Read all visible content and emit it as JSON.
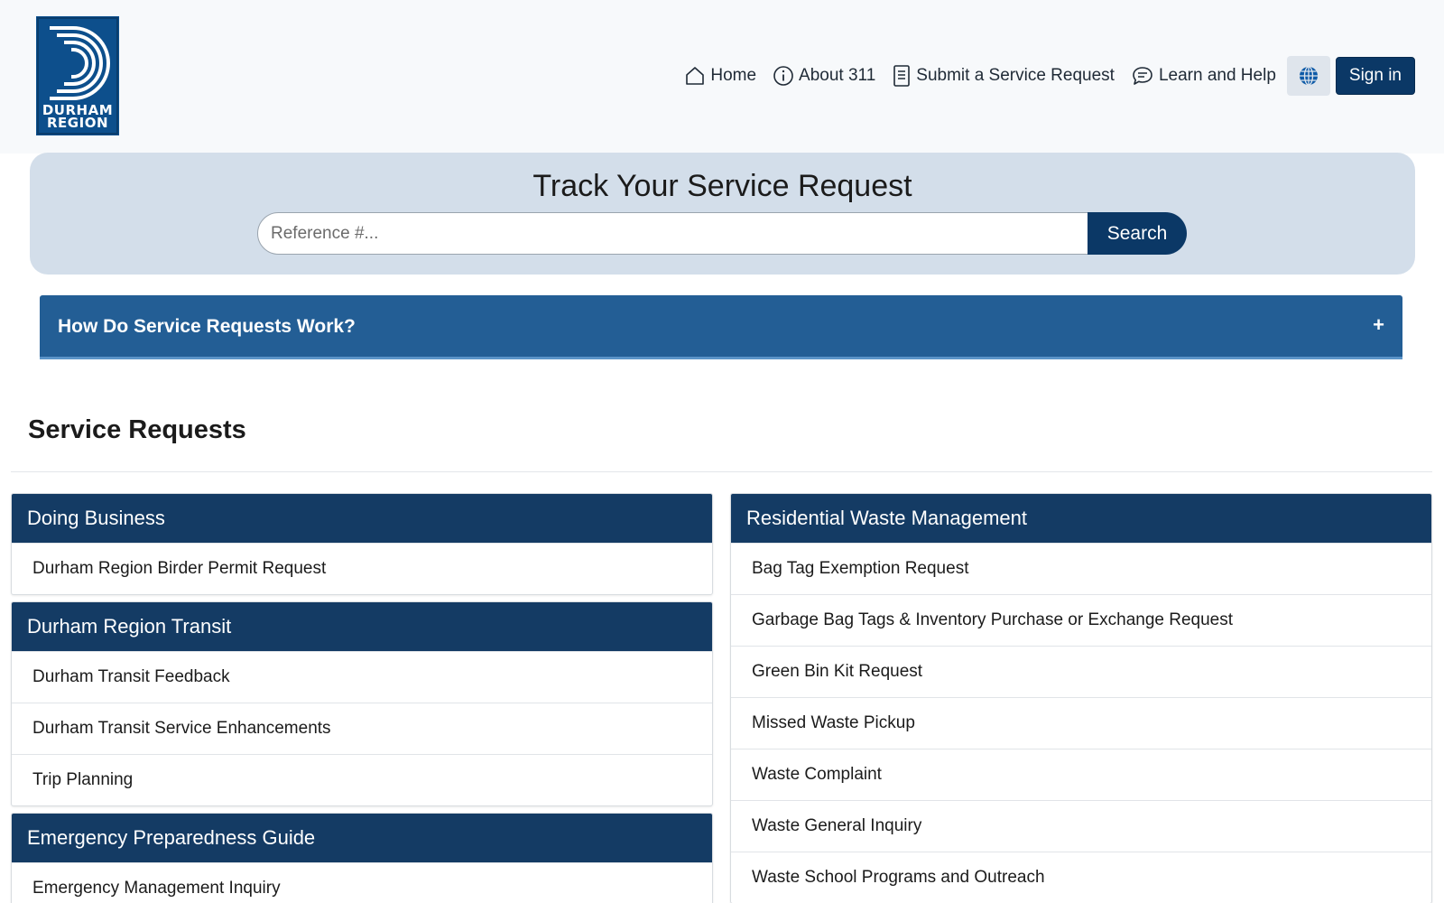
{
  "header": {
    "logo": {
      "line1": "DURHAM",
      "line2": "REGION"
    },
    "nav": [
      {
        "label": "Home",
        "icon": "home-icon"
      },
      {
        "label": "About 311",
        "icon": "info-icon"
      },
      {
        "label": "Submit a Service Request",
        "icon": "document-icon"
      },
      {
        "label": "Learn and Help",
        "icon": "chat-icon"
      }
    ],
    "language_icon": "globe-icon",
    "signin_label": "Sign in"
  },
  "track": {
    "title": "Track Your Service Request",
    "placeholder": "Reference #...",
    "search_label": "Search"
  },
  "accordion": {
    "title": "How Do Service Requests Work?",
    "toggle": "+"
  },
  "section": {
    "title": "Service Requests"
  },
  "groups_left": [
    {
      "title": "Doing Business",
      "items": [
        "Durham Region Birder Permit Request"
      ]
    },
    {
      "title": "Durham Region Transit",
      "items": [
        "Durham Transit Feedback",
        "Durham Transit Service Enhancements",
        "Trip Planning"
      ]
    },
    {
      "title": "Emergency Preparedness Guide",
      "items": [
        "Emergency Management Inquiry"
      ]
    }
  ],
  "groups_right": [
    {
      "title": "Residential Waste Management",
      "items": [
        "Bag Tag Exemption Request",
        "Garbage Bag Tags & Inventory Purchase or Exchange Request",
        "Green Bin Kit Request",
        "Missed Waste Pickup",
        "Waste Complaint",
        "Waste General Inquiry",
        "Waste School Programs and Outreach"
      ]
    }
  ],
  "colors": {
    "primary": "#0b3866",
    "group_header": "#143b64",
    "accordion": "#235e95",
    "track_bg": "#d3deea",
    "header_bg": "#f7f9fb"
  }
}
